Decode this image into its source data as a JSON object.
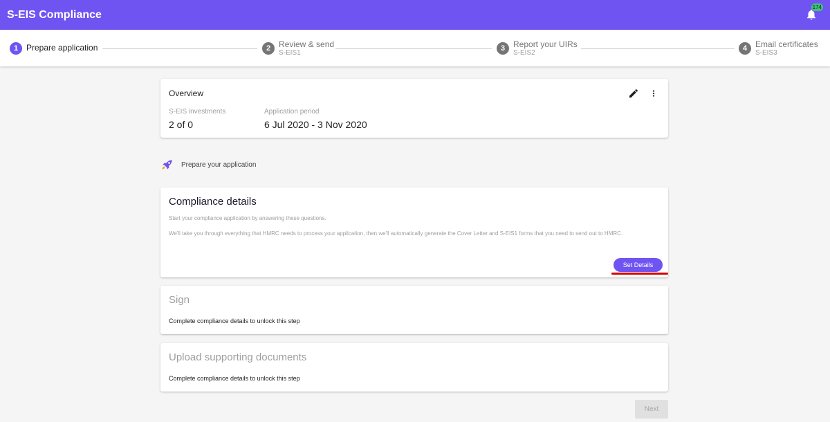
{
  "app": {
    "title": "S-EIS Compliance",
    "notification_count": "174",
    "accent_color": "#7054f2"
  },
  "stepper": {
    "steps": [
      {
        "number": "1",
        "label": "Prepare application",
        "sub": ""
      },
      {
        "number": "2",
        "label": "Review & send",
        "sub": "S-EIS1"
      },
      {
        "number": "3",
        "label": "Report your UIRs",
        "sub": "S-EIS2"
      },
      {
        "number": "4",
        "label": "Email certificates",
        "sub": "S-EIS3"
      }
    ]
  },
  "overview": {
    "title": "Overview",
    "investments_label": "S-EIS investments",
    "investments_value": "2 of 0",
    "period_label": "Application period",
    "period_value": "6 Jul 2020 - 3 Nov 2020",
    "edit_icon": "pencil-icon",
    "more_icon": "more-vert-icon"
  },
  "prepare": {
    "icon": "rocket-icon",
    "text": "Prepare your application"
  },
  "compliance": {
    "heading": "Compliance details",
    "p1": "Start your compliance application by answering these questions.",
    "p2": "We'll take you through everything that HMRC needs to process your application, then we'll automatically generate the Cover Letter and S-EIS1 forms that you need to send out to HMRC.",
    "button": "Set Details"
  },
  "sign": {
    "heading": "Sign",
    "text": "Complete compliance details to unlock this step"
  },
  "upload": {
    "heading": "Upload supporting documents",
    "text": "Complete compliance details to unlock this step"
  },
  "footer": {
    "next": "Next"
  }
}
